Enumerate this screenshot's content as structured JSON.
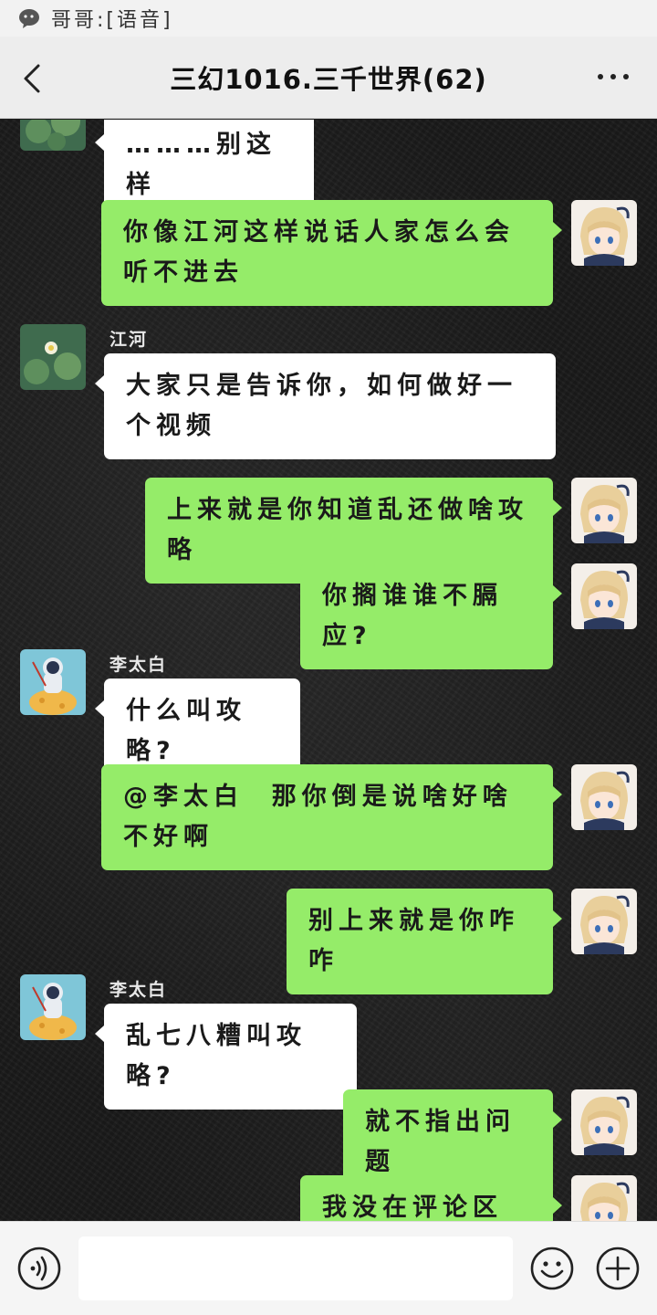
{
  "notification": {
    "text": "哥哥:[语音]"
  },
  "header": {
    "title": "三幻1016.三千世界(62)",
    "back_icon": "chevron-left-icon",
    "more_icon": "more-dots-icon"
  },
  "messages": [
    {
      "side": "left",
      "sender": "",
      "text": "………别这样",
      "avatar": "lotus-pond-avatar"
    },
    {
      "side": "right",
      "text": "你像江河这样说话人家怎么会听不进去",
      "avatar": "anime-girl-avatar"
    },
    {
      "side": "left",
      "sender": "江河",
      "text": "大家只是告诉你，如何做好一个视频",
      "avatar": "lotus-pond-avatar"
    },
    {
      "side": "right",
      "text": "上来就是你知道乱还做啥攻略",
      "avatar": "anime-girl-avatar"
    },
    {
      "side": "right",
      "text": "你搁谁谁不膈应?",
      "avatar": "anime-girl-avatar"
    },
    {
      "side": "left",
      "sender": "李太白",
      "text": "什么叫攻略?",
      "avatar": "astronaut-avatar"
    },
    {
      "side": "right",
      "text": "@李太白  那你倒是说啥好啥不好啊",
      "avatar": "anime-girl-avatar"
    },
    {
      "side": "right",
      "text": "别上来就是你咋咋",
      "avatar": "anime-girl-avatar"
    },
    {
      "side": "left",
      "sender": "李太白",
      "text": "乱七八糟叫攻略?",
      "avatar": "astronaut-avatar"
    },
    {
      "side": "right",
      "text": "就不指出问题",
      "avatar": "anime-girl-avatar"
    },
    {
      "side": "right",
      "text": "我没在评论区说?",
      "avatar": "anime-girl-avatar"
    }
  ],
  "input": {
    "value": "",
    "placeholder": ""
  },
  "toolbar": {
    "voice_icon": "voice-icon",
    "emoji_icon": "emoji-icon",
    "plus_icon": "plus-icon"
  },
  "colors": {
    "green_bubble": "#95ec69",
    "white_bubble": "#ffffff",
    "titlebar_bg": "#ededed",
    "chat_bg": "#1a1a1a"
  }
}
